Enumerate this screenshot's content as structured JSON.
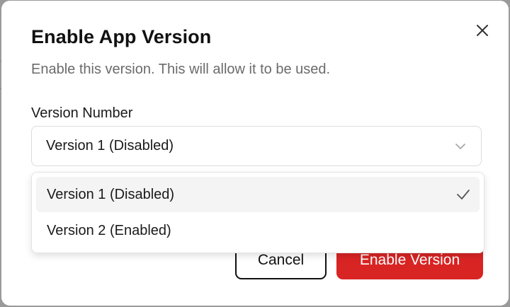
{
  "dialog": {
    "title": "Enable App Version",
    "description": "Enable this version. This will allow it to be used.",
    "close_icon": "close-icon"
  },
  "field": {
    "label": "Version Number",
    "selected_value": "Version 1 (Disabled)",
    "chevron_icon": "chevron-down-icon"
  },
  "dropdown": {
    "options": [
      {
        "label": "Version 1 (Disabled)",
        "selected": true
      },
      {
        "label": "Version 2 (Enabled)",
        "selected": false
      }
    ],
    "check_icon": "check-icon"
  },
  "footer": {
    "cancel_label": "Cancel",
    "confirm_label": "Enable Version"
  },
  "colors": {
    "accent": "#d92424",
    "overlay": "#9a9a9a"
  }
}
